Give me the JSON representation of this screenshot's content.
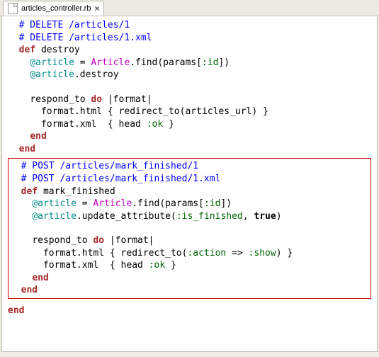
{
  "tab": {
    "filename": "articles_controller.rb"
  },
  "code": {
    "block1": {
      "comment1": "# DELETE /articles/1",
      "comment2": "# DELETE /articles/1.xml",
      "def_kw": "def",
      "def_name": " destroy",
      "ivar1": "@article",
      "eq": " = ",
      "const1": "Article",
      "find_call": ".find(params[",
      "sym_id": ":id",
      "close_br": "])",
      "ivar2": "@article",
      "destroy_call": ".destroy",
      "respond_to": "respond_to ",
      "do_kw": "do",
      "fmt_arg": " |format|",
      "fmt_html": "format.html { redirect_to(articles_url) }",
      "fmt_xml_pre": "format.xml  { head ",
      "sym_ok": ":ok",
      "fmt_xml_post": " }",
      "end_kw": "end"
    },
    "block2": {
      "comment1": "# POST /articles/mark_finished/1",
      "comment2": "# POST /articles/mark_finished/1.xml",
      "def_kw": "def",
      "def_name": " mark_finished",
      "ivar1": "@article",
      "eq": " = ",
      "const1": "Article",
      "find_call": ".find(params[",
      "sym_id": ":id",
      "close_br": "])",
      "ivar2": "@article",
      "upd_pre": ".update_attribute(",
      "sym_isfin": ":is_finished",
      "upd_mid": ", ",
      "true_lit": "true",
      "upd_post": ")",
      "respond_to": "respond_to ",
      "do_kw": "do",
      "fmt_arg": " |format|",
      "fmt_html_pre": "format.html { redirect_to(",
      "sym_action": ":action",
      "arrow": " => ",
      "sym_show": ":show",
      "fmt_html_post": ") }",
      "fmt_xml_pre": "format.xml  { head ",
      "sym_ok": ":ok",
      "fmt_xml_post": " }",
      "end_kw": "end"
    },
    "final_end": "end"
  }
}
